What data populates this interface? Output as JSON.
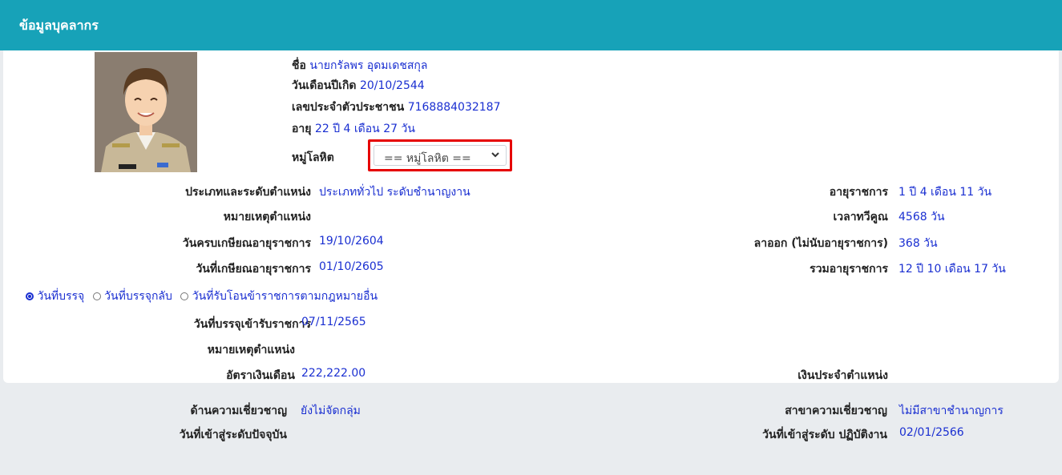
{
  "header": {
    "title": "ข้อมูลบุคลากร"
  },
  "personal": {
    "name_label": "ชื่อ",
    "name_value": "นายกรัลพร อุดมเดชสกุล",
    "birth_label": "วันเดือนปีเกิด",
    "birth_value": "20/10/2544",
    "id_label": "เลขประจำตัวประชาชน",
    "id_value": "7168884032187",
    "age_label": "อายุ",
    "age_value": "22 ปี 4 เดือน 27 วัน",
    "blood_label": "หมู่โลหิต",
    "blood_selected": "== หมู่โลหิต =="
  },
  "left_rows": [
    {
      "label": "ประเภทและระดับตำแหน่ง",
      "value": "ประเภททั่วไป ระดับชำนาญงาน"
    },
    {
      "label": "หมายเหตุตำแหน่ง",
      "value": ""
    },
    {
      "label": "วันครบเกษียณอายุราชการ",
      "value": "19/10/2604"
    },
    {
      "label": "วันที่เกษียณอายุราชการ",
      "value": "01/10/2605"
    }
  ],
  "right_rows": [
    {
      "label": "อายุราชการ",
      "value": "1 ปี 4 เดือน 11 วัน"
    },
    {
      "label": "เวลาทวีคูณ",
      "value": "4568 วัน"
    },
    {
      "label": "ลาออก (ไม่นับอายุราชการ)",
      "value": "368 วัน"
    },
    {
      "label": "รวมอายุราชการ",
      "value": "12 ปี 10 เดือน 17 วัน"
    }
  ],
  "radios": [
    {
      "label": "วันที่บรรจุ",
      "checked": true
    },
    {
      "label": "วันที่บรรจุกลับ",
      "checked": false
    },
    {
      "label": "วันที่รับโอนข้าราชการตามกฎหมายอื่น",
      "checked": false
    }
  ],
  "appoint": {
    "date_label": "วันที่บรรจุเข้ารับราชการ",
    "date_value": "07/11/2565",
    "note_label": "หมายเหตุตำแหน่ง",
    "salary_label": "อัตราเงินเดือน",
    "salary_value": "222,222.00",
    "position_pay_label": "เงินประจำตำแหน่ง"
  },
  "expertise": {
    "field_label": "ด้านความเชี่ยวชาญ",
    "field_value": "ยังไม่จัดกลุ่ม",
    "current_level_label": "วันที่เข้าสู่ระดับปัจจุบัน",
    "branch_label": "สาขาความเชี่ยวชาญ",
    "branch_value": "ไม่มีสาขาชำนาญการ",
    "level_date_label": "วันที่เข้าสู่ระดับ ปฏิบัติงาน",
    "level_date_value": "02/01/2566"
  },
  "colors": {
    "header": "#17a2b8",
    "value": "#1a2fd1",
    "highlight": "#e60000"
  }
}
